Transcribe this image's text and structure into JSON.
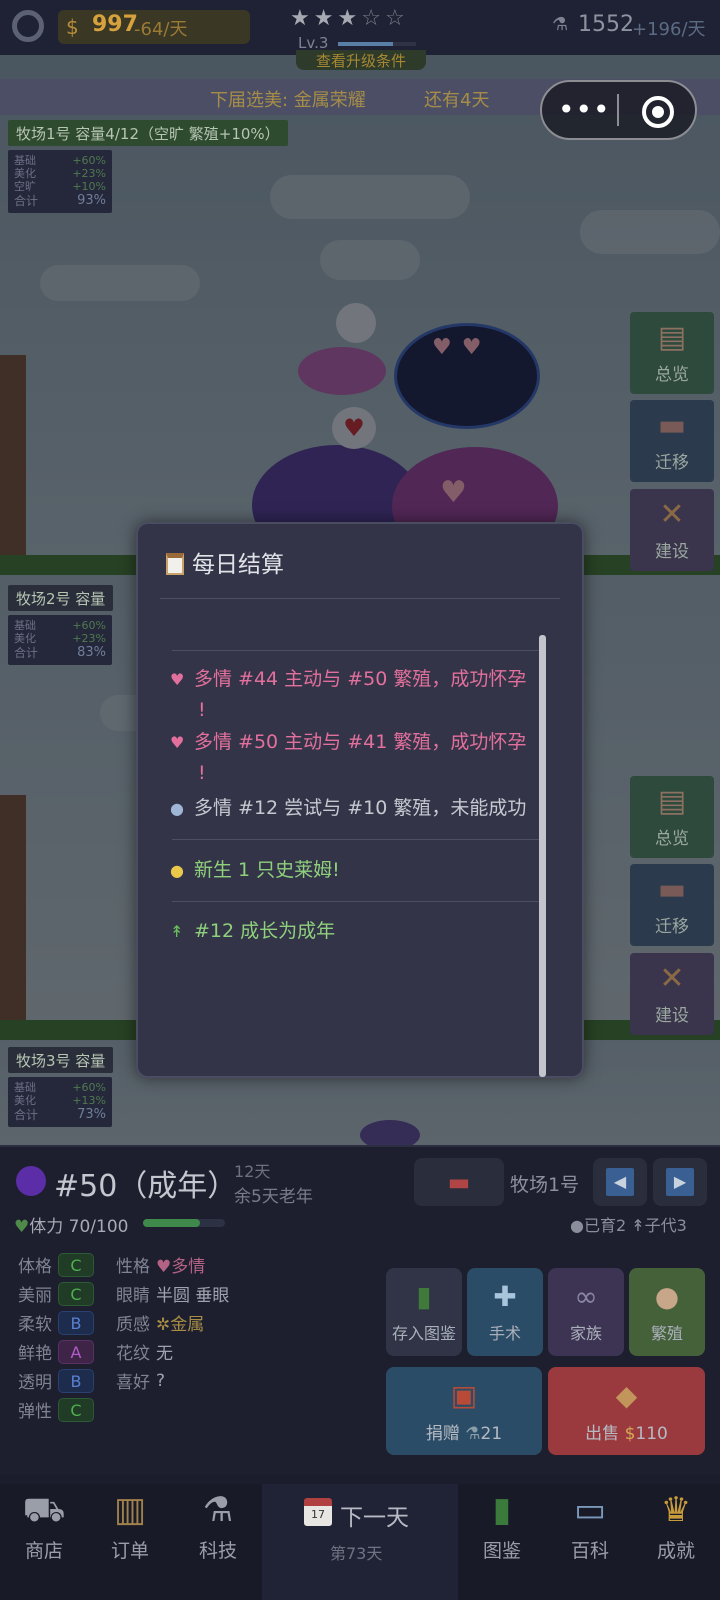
{
  "topbar": {
    "money": "997",
    "money_rate": "-64/天",
    "stars_total": 5,
    "stars_on": 3,
    "level": "Lv.3",
    "level_progress": 0.7,
    "upgrade_link": "查看升级条件",
    "tech": "1552",
    "tech_rate": "+196/天"
  },
  "election": {
    "text": "下届选美: 金属荣耀",
    "days": "还有4天"
  },
  "ranches": [
    {
      "tag": "牧场1号  容量4/12（空旷 繁殖+10%）",
      "stats": [
        {
          "label": "基础",
          "value": "+60%"
        },
        {
          "label": "美化",
          "value": "+23%"
        },
        {
          "label": "空旷",
          "value": "+10%"
        }
      ],
      "total_label": "合计",
      "total": "93%"
    },
    {
      "tag": "牧场2号  容量",
      "stats": [
        {
          "label": "基础",
          "value": "+60%"
        },
        {
          "label": "美化",
          "value": "+23%"
        }
      ],
      "total_label": "合计",
      "total": "83%"
    },
    {
      "tag": "牧场3号  容量",
      "stats": [
        {
          "label": "基础",
          "value": "+60%"
        },
        {
          "label": "美化",
          "value": "+13%"
        }
      ],
      "total_label": "合计",
      "total": "73%"
    }
  ],
  "side_buttons": {
    "overview": "总览",
    "migrate": "迁移",
    "build": "建设"
  },
  "modal": {
    "title": "每日结算",
    "logs": [
      {
        "line1": "多情 #44 主动与 #50 繁殖，成功怀孕",
        "line2": "!"
      },
      {
        "line1": "多情 #50 主动与 #41 繁殖，成功怀孕",
        "line2": "!"
      },
      {
        "line1": "多情 #12 尝试与 #10 繁殖，未能成功"
      }
    ],
    "birth": "新生 1 只史莱姆!",
    "growth": "#12 成长为成年"
  },
  "slime": {
    "name": "#50（成年）",
    "age_days": "12天",
    "age_remaining": "余5天老年",
    "ranch": "牧场1号",
    "hp_label": "体力 70/100",
    "hp_value": 70,
    "hp_max": 100,
    "born": "已育2",
    "children": "子代3",
    "attributes": [
      {
        "name": "体格",
        "grade": "C"
      },
      {
        "name": "美丽",
        "grade": "C"
      },
      {
        "name": "柔软",
        "grade": "B"
      },
      {
        "name": "鲜艳",
        "grade": "A"
      },
      {
        "name": "透明",
        "grade": "B"
      },
      {
        "name": "弹性",
        "grade": "C"
      }
    ],
    "traits": [
      {
        "name": "性格",
        "value": "多情"
      },
      {
        "name": "眼睛",
        "value": "半圆 垂眼"
      },
      {
        "name": "质感",
        "value": "金属"
      },
      {
        "name": "花纹",
        "value": "无"
      },
      {
        "name": "喜好",
        "value": "?"
      }
    ]
  },
  "actions": {
    "store": "存入图鉴",
    "surgery": "手术",
    "family": "家族",
    "breed": "繁殖",
    "donate": "捐赠",
    "donate_value": "21",
    "sell": "出售",
    "sell_value": "110"
  },
  "nav": {
    "shop": "商店",
    "orders": "订单",
    "tech": "科技",
    "next_day": "下一天",
    "calendar_num": "17",
    "day": "第73天",
    "dex": "图鉴",
    "wiki": "百科",
    "achievements": "成就"
  },
  "colors": {
    "accent_green": "#3f8a4b",
    "pink_log": "#e3709c",
    "sell_red": "#9b3a3e",
    "donate_blue": "#2b4c66"
  }
}
